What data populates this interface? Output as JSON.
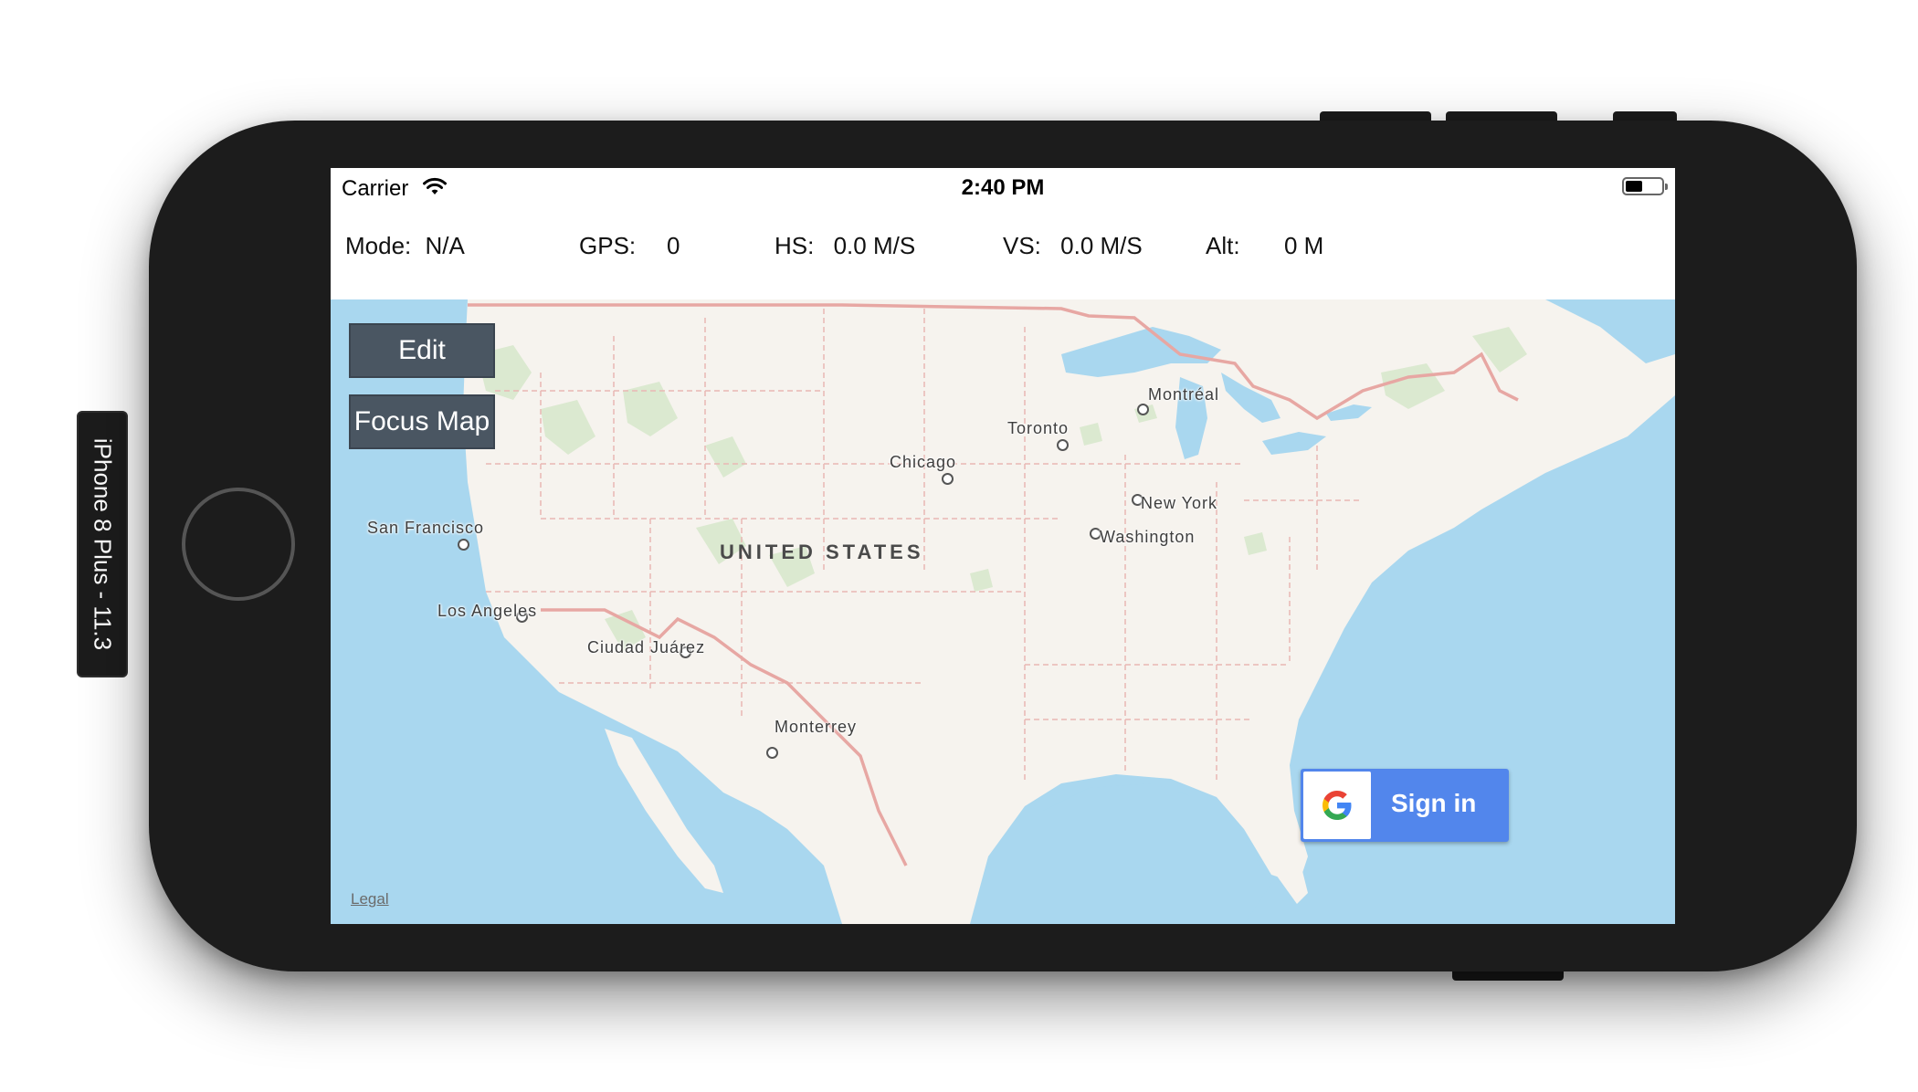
{
  "device": {
    "label": "iPhone 8 Plus - 11.3"
  },
  "status_bar": {
    "carrier": "Carrier",
    "time": "2:40 PM"
  },
  "telemetry": {
    "mode": {
      "label": "Mode:",
      "value": "N/A"
    },
    "gps": {
      "label": "GPS:",
      "value": "0"
    },
    "hs": {
      "label": "HS:",
      "value": "0.0 M/S"
    },
    "vs": {
      "label": "VS:",
      "value": "0.0 M/S"
    },
    "alt": {
      "label": "Alt:",
      "value": "0 M"
    }
  },
  "map": {
    "country": "UNITED STATES",
    "cities": {
      "montreal": "Montréal",
      "toronto": "Toronto",
      "chicago": "Chicago",
      "new_york": "New York",
      "washington": "Washington",
      "san_francisco": "San Francisco",
      "los_angeles": "Los Angeles",
      "ciudad_juarez": "Ciudad Juárez",
      "monterrey": "Monterrey"
    },
    "legal": "Legal",
    "colors": {
      "water": "#a9d7ef",
      "land": "#f6f3ee",
      "border": "#e9a9a4"
    }
  },
  "buttons": {
    "edit": "Edit",
    "focus_map": "Focus Map"
  },
  "google_signin": {
    "label": "Sign in",
    "accent": "#5286ec"
  }
}
